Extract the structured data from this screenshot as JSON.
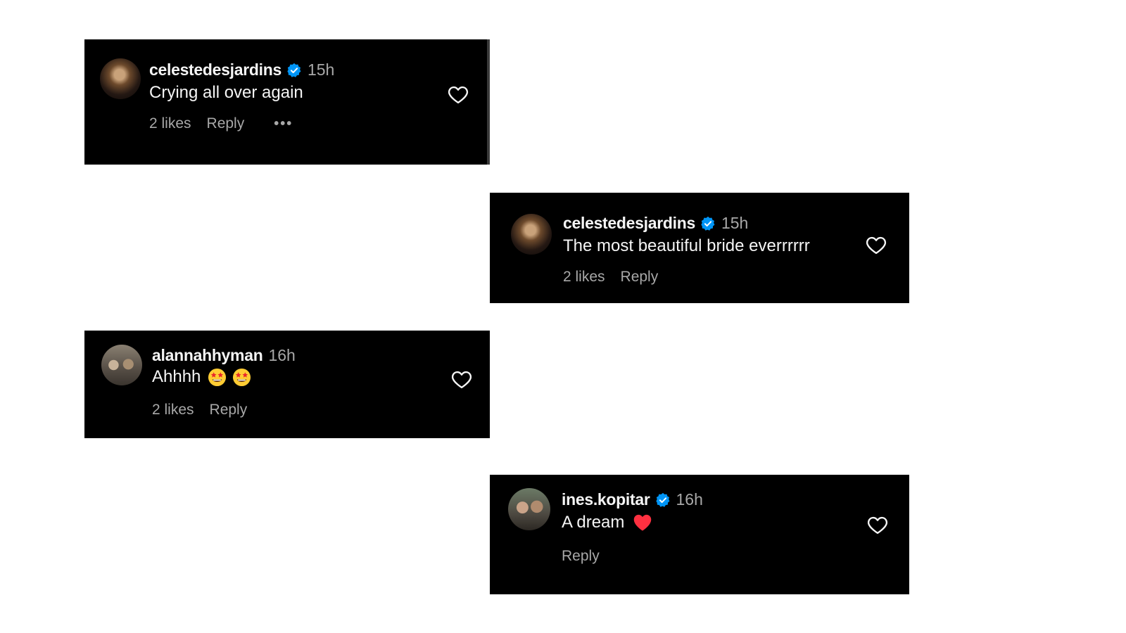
{
  "comments": [
    {
      "username": "celestedesjardins",
      "verified": true,
      "time": "15h",
      "text": "Crying all over again",
      "likes": "2 likes",
      "reply": "Reply",
      "more": "•••",
      "avatar": "woman-portrait"
    },
    {
      "username": "celestedesjardins",
      "verified": true,
      "time": "15h",
      "text": "The most beautiful bride everrrrrr",
      "likes": "2 likes",
      "reply": "Reply",
      "avatar": "woman-portrait"
    },
    {
      "username": "alannahhyman",
      "verified": false,
      "time": "16h",
      "text": "Ahhhh",
      "emojis": [
        "star-struck",
        "star-struck"
      ],
      "likes": "2 likes",
      "reply": "Reply",
      "avatar": "group-photo"
    },
    {
      "username": "ines.kopitar",
      "verified": true,
      "time": "16h",
      "text": "A dream",
      "emojis": [
        "red-heart"
      ],
      "reply": "Reply",
      "avatar": "couple-photo"
    }
  ],
  "colors": {
    "card_background": "#000000",
    "page_background": "#ffffff",
    "primary_text": "#f5f5f5",
    "secondary_text": "#a8a8a8",
    "verified_badge": "#0095f6",
    "red_heart": "#ff3040"
  }
}
